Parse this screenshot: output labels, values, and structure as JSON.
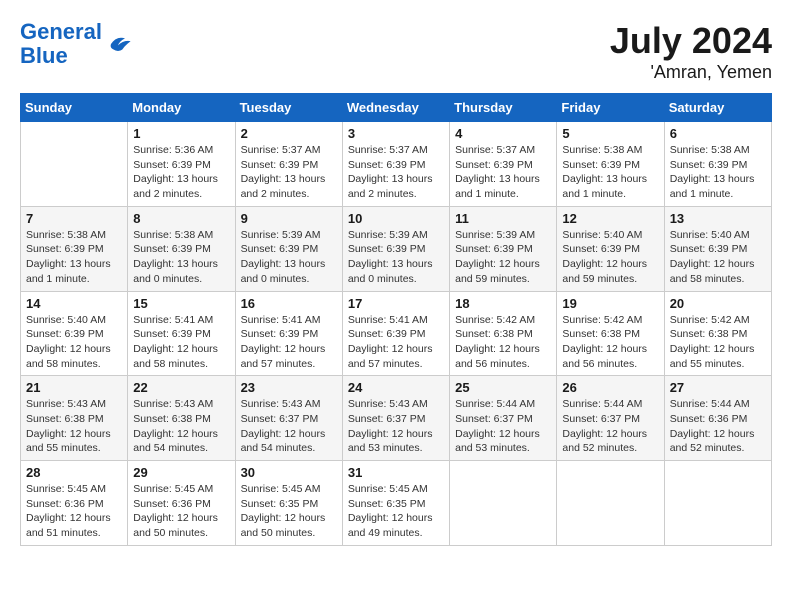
{
  "header": {
    "logo_line1": "General",
    "logo_line2": "Blue",
    "main_title": "July 2024",
    "sub_title": "'Amran, Yemen"
  },
  "days_of_week": [
    "Sunday",
    "Monday",
    "Tuesday",
    "Wednesday",
    "Thursday",
    "Friday",
    "Saturday"
  ],
  "weeks": [
    [
      {
        "day": "",
        "info": ""
      },
      {
        "day": "1",
        "info": "Sunrise: 5:36 AM\nSunset: 6:39 PM\nDaylight: 13 hours\nand 2 minutes."
      },
      {
        "day": "2",
        "info": "Sunrise: 5:37 AM\nSunset: 6:39 PM\nDaylight: 13 hours\nand 2 minutes."
      },
      {
        "day": "3",
        "info": "Sunrise: 5:37 AM\nSunset: 6:39 PM\nDaylight: 13 hours\nand 2 minutes."
      },
      {
        "day": "4",
        "info": "Sunrise: 5:37 AM\nSunset: 6:39 PM\nDaylight: 13 hours\nand 1 minute."
      },
      {
        "day": "5",
        "info": "Sunrise: 5:38 AM\nSunset: 6:39 PM\nDaylight: 13 hours\nand 1 minute."
      },
      {
        "day": "6",
        "info": "Sunrise: 5:38 AM\nSunset: 6:39 PM\nDaylight: 13 hours\nand 1 minute."
      }
    ],
    [
      {
        "day": "7",
        "info": "Sunrise: 5:38 AM\nSunset: 6:39 PM\nDaylight: 13 hours\nand 1 minute."
      },
      {
        "day": "8",
        "info": "Sunrise: 5:38 AM\nSunset: 6:39 PM\nDaylight: 13 hours\nand 0 minutes."
      },
      {
        "day": "9",
        "info": "Sunrise: 5:39 AM\nSunset: 6:39 PM\nDaylight: 13 hours\nand 0 minutes."
      },
      {
        "day": "10",
        "info": "Sunrise: 5:39 AM\nSunset: 6:39 PM\nDaylight: 13 hours\nand 0 minutes."
      },
      {
        "day": "11",
        "info": "Sunrise: 5:39 AM\nSunset: 6:39 PM\nDaylight: 12 hours\nand 59 minutes."
      },
      {
        "day": "12",
        "info": "Sunrise: 5:40 AM\nSunset: 6:39 PM\nDaylight: 12 hours\nand 59 minutes."
      },
      {
        "day": "13",
        "info": "Sunrise: 5:40 AM\nSunset: 6:39 PM\nDaylight: 12 hours\nand 58 minutes."
      }
    ],
    [
      {
        "day": "14",
        "info": "Sunrise: 5:40 AM\nSunset: 6:39 PM\nDaylight: 12 hours\nand 58 minutes."
      },
      {
        "day": "15",
        "info": "Sunrise: 5:41 AM\nSunset: 6:39 PM\nDaylight: 12 hours\nand 58 minutes."
      },
      {
        "day": "16",
        "info": "Sunrise: 5:41 AM\nSunset: 6:39 PM\nDaylight: 12 hours\nand 57 minutes."
      },
      {
        "day": "17",
        "info": "Sunrise: 5:41 AM\nSunset: 6:39 PM\nDaylight: 12 hours\nand 57 minutes."
      },
      {
        "day": "18",
        "info": "Sunrise: 5:42 AM\nSunset: 6:38 PM\nDaylight: 12 hours\nand 56 minutes."
      },
      {
        "day": "19",
        "info": "Sunrise: 5:42 AM\nSunset: 6:38 PM\nDaylight: 12 hours\nand 56 minutes."
      },
      {
        "day": "20",
        "info": "Sunrise: 5:42 AM\nSunset: 6:38 PM\nDaylight: 12 hours\nand 55 minutes."
      }
    ],
    [
      {
        "day": "21",
        "info": "Sunrise: 5:43 AM\nSunset: 6:38 PM\nDaylight: 12 hours\nand 55 minutes."
      },
      {
        "day": "22",
        "info": "Sunrise: 5:43 AM\nSunset: 6:38 PM\nDaylight: 12 hours\nand 54 minutes."
      },
      {
        "day": "23",
        "info": "Sunrise: 5:43 AM\nSunset: 6:37 PM\nDaylight: 12 hours\nand 54 minutes."
      },
      {
        "day": "24",
        "info": "Sunrise: 5:43 AM\nSunset: 6:37 PM\nDaylight: 12 hours\nand 53 minutes."
      },
      {
        "day": "25",
        "info": "Sunrise: 5:44 AM\nSunset: 6:37 PM\nDaylight: 12 hours\nand 53 minutes."
      },
      {
        "day": "26",
        "info": "Sunrise: 5:44 AM\nSunset: 6:37 PM\nDaylight: 12 hours\nand 52 minutes."
      },
      {
        "day": "27",
        "info": "Sunrise: 5:44 AM\nSunset: 6:36 PM\nDaylight: 12 hours\nand 52 minutes."
      }
    ],
    [
      {
        "day": "28",
        "info": "Sunrise: 5:45 AM\nSunset: 6:36 PM\nDaylight: 12 hours\nand 51 minutes."
      },
      {
        "day": "29",
        "info": "Sunrise: 5:45 AM\nSunset: 6:36 PM\nDaylight: 12 hours\nand 50 minutes."
      },
      {
        "day": "30",
        "info": "Sunrise: 5:45 AM\nSunset: 6:35 PM\nDaylight: 12 hours\nand 50 minutes."
      },
      {
        "day": "31",
        "info": "Sunrise: 5:45 AM\nSunset: 6:35 PM\nDaylight: 12 hours\nand 49 minutes."
      },
      {
        "day": "",
        "info": ""
      },
      {
        "day": "",
        "info": ""
      },
      {
        "day": "",
        "info": ""
      }
    ]
  ]
}
